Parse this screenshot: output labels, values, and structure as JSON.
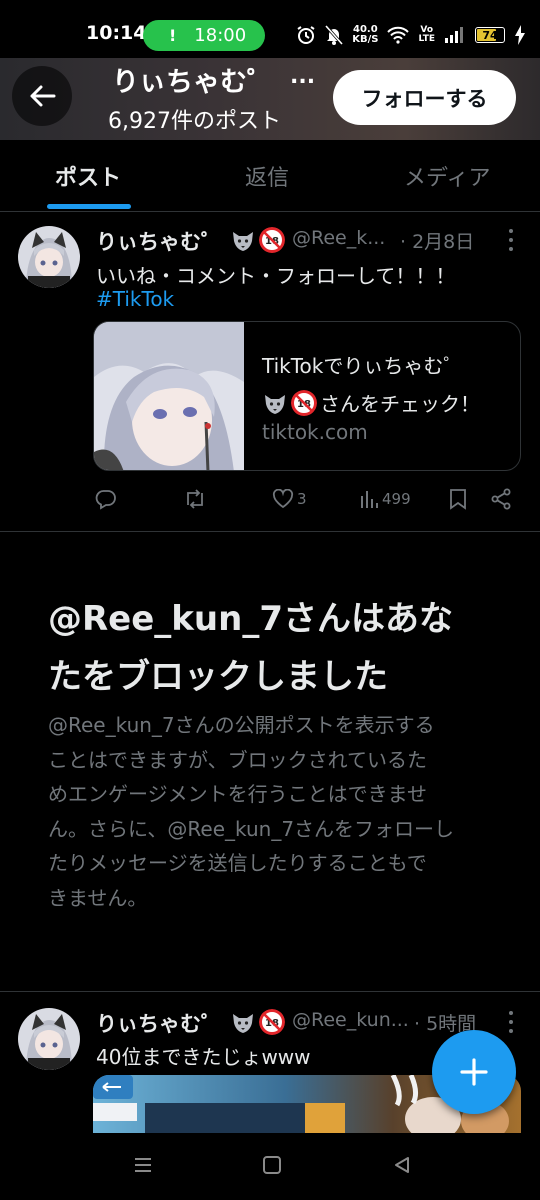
{
  "status_bar": {
    "time": "10:14",
    "call_pill_time": "18:00",
    "call_pill_color": "#27c24c",
    "network_speed_value": "40.0",
    "network_speed_unit": "KB/S",
    "volte_line1": "Vo",
    "volte_line2": "LTE",
    "battery_level": "74",
    "icons": [
      "alarm-icon",
      "mute-icon",
      "wifi-icon",
      "volte-icon",
      "signal-icon",
      "battery-icon",
      "charging-icon"
    ]
  },
  "header": {
    "profile_name": "りぃちゃむ゜",
    "ellipsis": "...",
    "post_count": "6,927件のポスト",
    "follow_label": "フォローする"
  },
  "tabs": [
    {
      "label": "ポスト",
      "active": true
    },
    {
      "label": "返信",
      "active": false
    },
    {
      "label": "メディア",
      "active": false
    }
  ],
  "accent_color": "#1d9bf0",
  "posts": [
    {
      "name": "りぃちゃむ゜",
      "handle": "@Ree_k...",
      "date": "· 2月8日",
      "text": "いいね・コメント・フォローして！！！",
      "hashtag": "#TikTok",
      "card": {
        "title_line1": "TikTokでりぃちゃむ゜",
        "title_line2": "さんをチェック！",
        "domain": "tiktok.com"
      },
      "actions": {
        "likes": "3",
        "views": "499"
      }
    },
    {
      "name": "りぃちゃむ゜",
      "handle": "@Ree_kun...",
      "date": "· 5時間",
      "text": "40位まできたじょwww"
    }
  ],
  "blocked_notice": {
    "title_line1": "@Ree_kun_7さんはあな",
    "title_line2": "たをブロックしました",
    "body_lines": [
      "@Ree_kun_7さんの公開ポストを表示する",
      "ことはできますが、ブロックされているた",
      "めエンゲージメントを行うことはできませ",
      "ん。さらに、@Ree_kun_7さんをフォローし",
      "たりメッセージを送信したりすることもで",
      "きません。"
    ]
  }
}
